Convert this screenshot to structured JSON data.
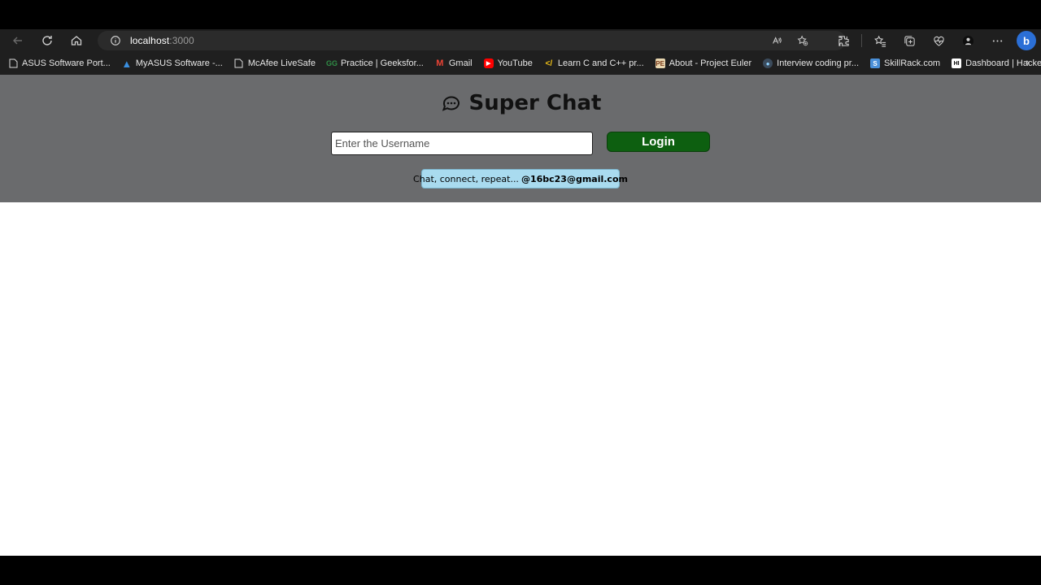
{
  "browser": {
    "url_host": "localhost",
    "url_port": ":3000",
    "bookmarks": [
      {
        "label": "ASUS Software Port...",
        "icon": "page-icon"
      },
      {
        "label": "MyASUS Software -...",
        "icon": "myasus-icon"
      },
      {
        "label": "McAfee LiveSafe",
        "icon": "page-icon"
      },
      {
        "label": "Practice | Geeksfor...",
        "icon": "geeksforgeeks-icon"
      },
      {
        "label": "Gmail",
        "icon": "gmail-icon"
      },
      {
        "label": "YouTube",
        "icon": "youtube-icon"
      },
      {
        "label": "Learn C and C++ pr...",
        "icon": "learn-c-icon"
      },
      {
        "label": "About - Project Euler",
        "icon": "project-euler-icon"
      },
      {
        "label": "Interview coding pr...",
        "icon": "interview-icon"
      },
      {
        "label": "SkillRack.com",
        "icon": "skillrack-icon"
      },
      {
        "label": "Dashboard | Hacker...",
        "icon": "hackerrank-icon"
      }
    ]
  },
  "app": {
    "title": "Super Chat",
    "username_placeholder": "Enter the Username",
    "login_label": "Login",
    "tagline_text": "Chat, connect, repeat...",
    "tagline_email": "@16bc23@gmail.com"
  },
  "colors": {
    "header_bg": "#6a6b6d",
    "login_bg": "#0d5f10",
    "tagline_bg": "#a9dbef"
  }
}
